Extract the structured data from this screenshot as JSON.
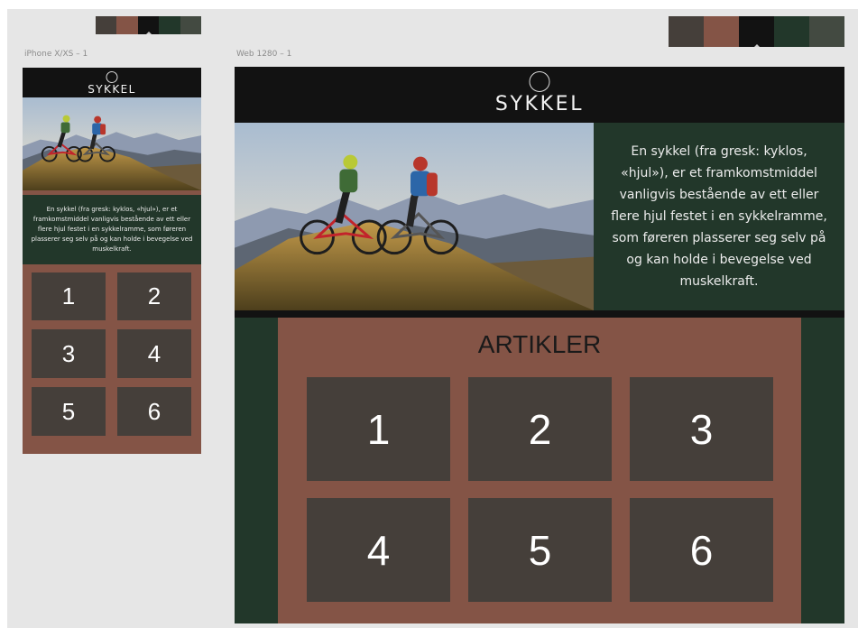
{
  "palette_colors": [
    "#453f3a",
    "#845446",
    "#121212",
    "#22372a",
    "#434a41"
  ],
  "mobile": {
    "frame_label": "iPhone X/XS – 1",
    "brand": "SYKKEL",
    "intro_text": "En sykkel (fra gresk: kyklos, «hjul»),  er et framkomstmiddel vanligvis bestående av ett eller flere hjul festet i en sykkelramme, som føreren plasserer seg selv på og kan holde i bevegelse ved muskelkraft.",
    "tiles": [
      "1",
      "2",
      "3",
      "4",
      "5",
      "6"
    ]
  },
  "web": {
    "frame_label": "Web 1280 – 1",
    "brand": "SYKKEL",
    "intro_text": "En sykkel (fra gresk: kyklos, «hjul»),  er et framkomstmiddel vanligvis bestående av ett eller flere hjul festet i en sykkelramme, som føreren plasserer seg selv på og kan holde i bevegelse ved muskelkraft.",
    "articles_heading": "ARTIKLER",
    "tiles": [
      "1",
      "2",
      "3",
      "4",
      "5",
      "6"
    ]
  },
  "colors": {
    "header_bg": "#121212",
    "intro_bg": "#22372a",
    "articles_bg": "#845446",
    "tile_bg": "#453f3a",
    "canvas_bg": "#e6e6e6"
  }
}
